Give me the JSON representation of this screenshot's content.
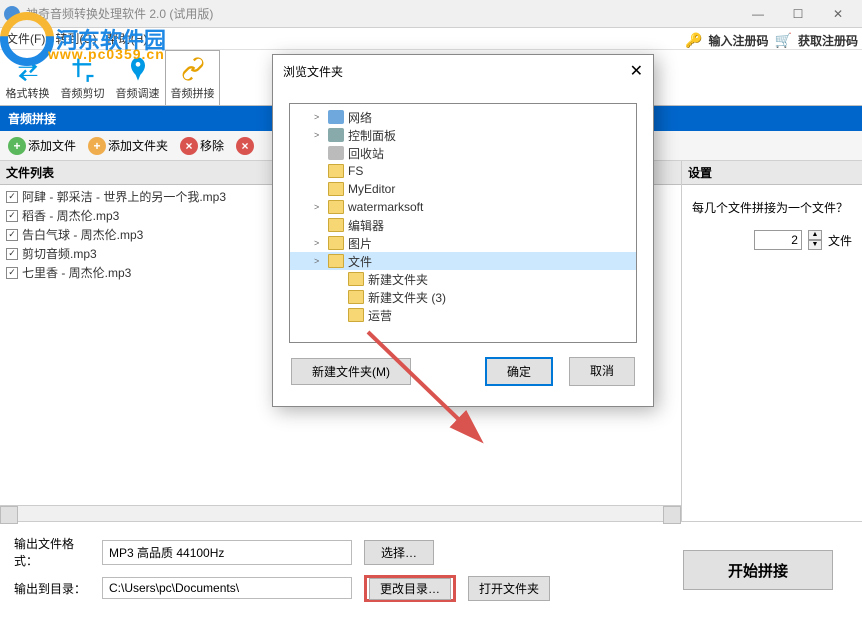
{
  "titlebar": {
    "title": "神奇音频转换处理软件 2.0 (试用版)"
  },
  "watermark": {
    "text": "河东软件园",
    "url": "www.pc0359.cn"
  },
  "menu": {
    "file": "文件(F)",
    "convert": "转到(G)",
    "help": "帮助(H)"
  },
  "topright": {
    "regcode": "输入注册码",
    "getcode": "获取注册码"
  },
  "toolbar": {
    "convert": "格式转换",
    "trim": "音频剪切",
    "speed": "音频调速",
    "concat": "音频拼接"
  },
  "section": "音频拼接",
  "actions": {
    "addfile": "添加文件",
    "addfolder": "添加文件夹",
    "remove": "移除"
  },
  "listheader": "文件列表",
  "files": [
    "阿肆 - 郭采洁 - 世界上的另一个我.mp3",
    "稻香 - 周杰伦.mp3",
    "告白气球 - 周杰伦.mp3",
    "剪切音频.mp3",
    "七里香 - 周杰伦.mp3"
  ],
  "settings": {
    "header": "设置",
    "question": "每几个文件拼接为一个文件？",
    "value": "2",
    "unit": "文件"
  },
  "bottom": {
    "fmt_label": "输出文件格式：",
    "fmt_value": "MP3 高品质 44100Hz",
    "choose": "选择…",
    "out_label": "输出到目录：",
    "out_value": "C:\\Users\\pc\\Documents\\",
    "change": "更改目录…",
    "open": "打开文件夹",
    "start": "开始拼接"
  },
  "dialog": {
    "title": "浏览文件夹",
    "tree": [
      {
        "label": "网络",
        "icon": "net",
        "level": 1,
        "exp": ">"
      },
      {
        "label": "控制面板",
        "icon": "ctrl",
        "level": 1,
        "exp": ">"
      },
      {
        "label": "回收站",
        "icon": "bin",
        "level": 1,
        "exp": ""
      },
      {
        "label": "FS",
        "icon": "folder",
        "level": 1,
        "exp": ""
      },
      {
        "label": "MyEditor",
        "icon": "folder",
        "level": 1,
        "exp": ""
      },
      {
        "label": "watermarksoft",
        "icon": "folder",
        "level": 1,
        "exp": ">"
      },
      {
        "label": "编辑器",
        "icon": "folder",
        "level": 1,
        "exp": ""
      },
      {
        "label": "图片",
        "icon": "folder",
        "level": 1,
        "exp": ">"
      },
      {
        "label": "文件",
        "icon": "folder",
        "level": 1,
        "exp": ">",
        "sel": true
      },
      {
        "label": "新建文件夹",
        "icon": "folder",
        "level": 2,
        "exp": ""
      },
      {
        "label": "新建文件夹 (3)",
        "icon": "folder",
        "level": 2,
        "exp": ""
      },
      {
        "label": "运营",
        "icon": "folder",
        "level": 2,
        "exp": ""
      }
    ],
    "newfolder": "新建文件夹(M)",
    "ok": "确定",
    "cancel": "取消"
  }
}
